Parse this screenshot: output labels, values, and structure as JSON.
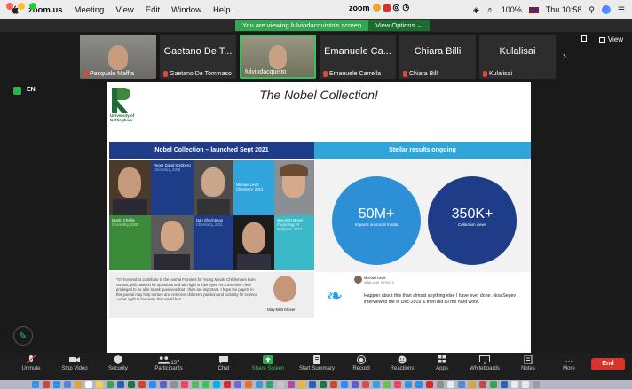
{
  "menubar": {
    "app": "zoom.us",
    "items": [
      "Meeting",
      "View",
      "Edit",
      "Window",
      "Help"
    ],
    "zoom_label": "zoom",
    "battery": "100%",
    "clock": "Thu 10:58"
  },
  "banner": {
    "message": "You are viewing fulviodacquisto's screen",
    "options": "View Options ⌄"
  },
  "participants": [
    {
      "name": "Pasquale Maffia",
      "big": ""
    },
    {
      "name": "Gaetano De Tommaso",
      "big": "Gaetano De T..."
    },
    {
      "name": "fulviodacquisto",
      "big": ""
    },
    {
      "name": "Emanuele Carrella",
      "big": "Emanuele Ca..."
    },
    {
      "name": "Chiara Billi",
      "big": "Chiara Billi"
    },
    {
      "name": "Kulalisai",
      "big": "Kulalisai"
    }
  ],
  "view_label": "View",
  "lang_badge": "EN",
  "slide": {
    "title": "The Nobel Collection!",
    "university": "University of Nottingham",
    "left_header": "Nobel Collection – launched Sept 2021",
    "right_header": "Stellar results ongoing",
    "laureates": [
      {
        "name": "Roger David Kornberg",
        "field": "Chemistry",
        "year": "2006"
      },
      {
        "name": "Michael Levitt",
        "field": "Chemistry",
        "year": "2013"
      },
      {
        "name": "Martin Chalfie",
        "field": "Chemistry",
        "year": "2008"
      },
      {
        "name": "Dan Shechtman",
        "field": "Chemistry",
        "year": "2011"
      },
      {
        "name": "May-Britt Moser",
        "field": "Physiology or Medicine",
        "year": "2014"
      }
    ],
    "stat1_value": "50M+",
    "stat1_label": "Impacts on social media",
    "stat2_value": "350K+",
    "stat2_label": "Collection views",
    "quote": "“I'm honored to contribute to the journal Frontiers for Young Minds. Children are born curious, with passion for questions and with light in their eyes. As a scientist, I feel privileged to be able to ask questions that I think are important. I hope the papers in this journal may help nurture and reinforce children's passion and curiosity for science - what a gift to humanity that would be!”",
    "quote_author": "May-Britt Moser",
    "tweet_author": "Michael Levitt",
    "tweet_handle": "@MLevitt_NP2013",
    "tweet_text": "Happier about this than almost anything else I have ever done. Noa Segev interviewed me in Dec-2019 & then did all the hard work."
  },
  "toolbar": {
    "unmute": "Unmute",
    "stop_video": "Stop Video",
    "security": "Security",
    "participants": "Participants",
    "participants_count": "137",
    "chat": "Chat",
    "share_screen": "Share Screen",
    "start_summary": "Start Summary",
    "record": "Record",
    "reactions": "Reactions",
    "apps": "Apps",
    "whiteboards": "Whiteboards",
    "notes": "Notes",
    "more": "More",
    "end": "End"
  },
  "colors": {
    "share_green": "#33a853",
    "end_red": "#d9342b",
    "navy": "#1f3c88",
    "sky": "#2fa5dc",
    "uni_green": "#1f6b3a"
  }
}
